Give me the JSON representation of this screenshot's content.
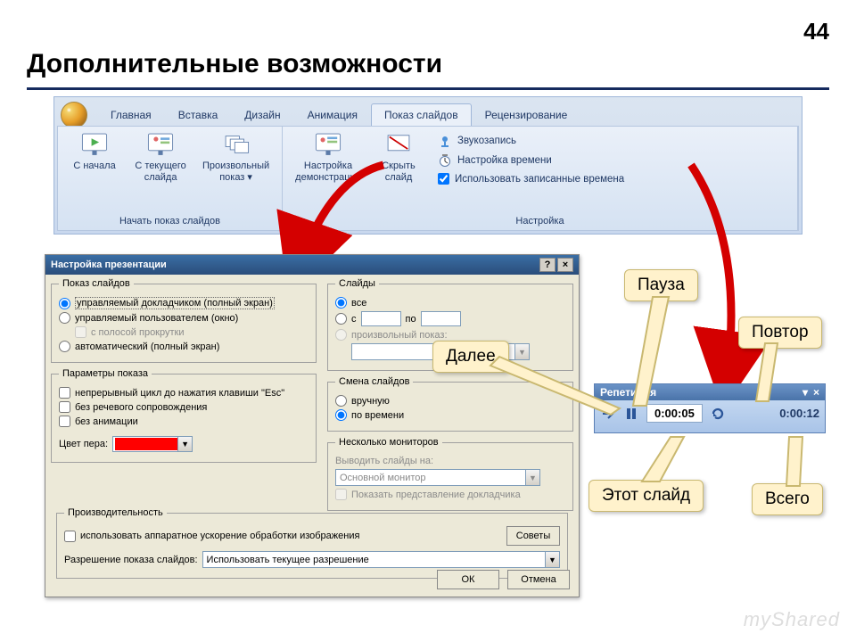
{
  "page_number": "44",
  "heading": "Дополнительные возможности",
  "ribbon": {
    "tabs": [
      "Главная",
      "Вставка",
      "Дизайн",
      "Анимация",
      "Показ слайдов",
      "Рецензирование"
    ],
    "active_tab_index": 4,
    "group1_label": "Начать показ слайдов",
    "btn_from_start": "С начала",
    "btn_from_current": "С текущего слайда",
    "btn_custom": "Произвольный показ ▾",
    "group2_label": "Настройка",
    "btn_setup": "Настройка демонстрации",
    "btn_hide": "Скрыть слайд",
    "mini_record": "Звукозапись",
    "mini_rehearse": "Настройка времени",
    "mini_use_timings": "Использовать записанные времена"
  },
  "dialog": {
    "title": "Настройка презентации",
    "groups": {
      "show_type": "Показ слайдов",
      "show_type_opts": {
        "o1": "управляемый докладчиком (полный экран)",
        "o2": "управляемый пользователем (окно)",
        "o2chk": "с полосой прокрутки",
        "o3": "автоматический (полный экран)"
      },
      "slides": "Слайды",
      "slides_opts": {
        "all": "все",
        "from": "с",
        "to": "по",
        "custom": "произвольный показ:"
      },
      "show_opts": "Параметры показа",
      "show_opts_items": {
        "c1": "непрерывный цикл до нажатия клавиши \"Esc\"",
        "c2": "без речевого сопровождения",
        "c3": "без анимации",
        "pen": "Цвет пера:"
      },
      "advance": "Смена слайдов",
      "advance_opts": {
        "manual": "вручную",
        "timing": "по времени"
      },
      "monitors": "Несколько мониторов",
      "monitors_items": {
        "out": "Выводить слайды на:",
        "primary": "Основной монитор",
        "presenter": "Показать представление докладчика"
      },
      "perf": "Производительность",
      "perf_items": {
        "hw": "использовать аппаратное ускорение обработки изображения",
        "tips": "Советы",
        "res_lbl": "Разрешение показа слайдов:",
        "res_val": "Использовать текущее разрешение"
      }
    },
    "ok": "ОК",
    "cancel": "Отмена"
  },
  "rehearsal": {
    "title": "Репетиция",
    "slide_time": "0:00:05",
    "total_time": "0:00:12"
  },
  "callouts": {
    "next": "Далее",
    "pause": "Пауза",
    "repeat": "Повтор",
    "this_slide": "Этот слайд",
    "total": "Всего"
  },
  "watermark": "myShared"
}
